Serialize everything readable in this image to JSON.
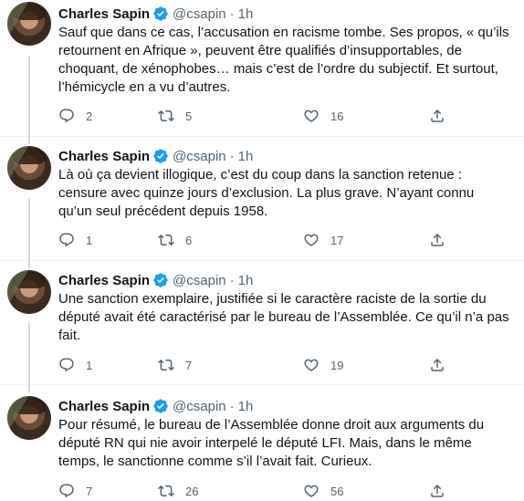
{
  "tweets": [
    {
      "name": "Charles Sapin",
      "handle": "@csapin",
      "separator": "·",
      "time": "1h",
      "text": "Sauf que dans ce cas, l’accusation en racisme tombe. Ses propos, « qu’ils retournent en Afrique », peuvent être qualifiés d’insupportables, de choquant, de xénophobes… mais c’est de l’ordre du subjectif. Et surtout, l’hémicycle en a vu d’autres.",
      "replies": "2",
      "retweets": "5",
      "likes": "16"
    },
    {
      "name": "Charles Sapin",
      "handle": "@csapin",
      "separator": "·",
      "time": "1h",
      "text": "Là où ça devient illogique, c’est du coup dans la sanction retenue : censure avec quinze jours d’exclusion. La plus grave. N’ayant connu qu’un seul précédent depuis 1958.",
      "replies": "1",
      "retweets": "6",
      "likes": "17"
    },
    {
      "name": "Charles Sapin",
      "handle": "@csapin",
      "separator": "·",
      "time": "1h",
      "text": "Une sanction exemplaire, justifiée si le caractère raciste de la sortie du député avait été caractérisé par le bureau de l’Assemblée. Ce qu’il n’a pas fait.",
      "replies": "1",
      "retweets": "7",
      "likes": "19"
    },
    {
      "name": "Charles Sapin",
      "handle": "@csapin",
      "separator": "·",
      "time": "1h",
      "text": "Pour résumé, le bureau de l’Assemblée donne droit aux arguments du député RN qui nie avoir interpelé le député LFI. Mais, dans le même temps, le sanctionne comme s’il l’avait fait. Curieux.",
      "replies": "7",
      "retweets": "26",
      "likes": "56"
    }
  ],
  "icons": {
    "verified": "verified-badge-icon",
    "reply": "reply-icon",
    "retweet": "retweet-icon",
    "like": "like-icon",
    "share": "share-icon"
  },
  "colors": {
    "text": "#0f1419",
    "secondary": "#536471",
    "verified": "#1d9bf0",
    "thread_line": "#cfd9de"
  }
}
